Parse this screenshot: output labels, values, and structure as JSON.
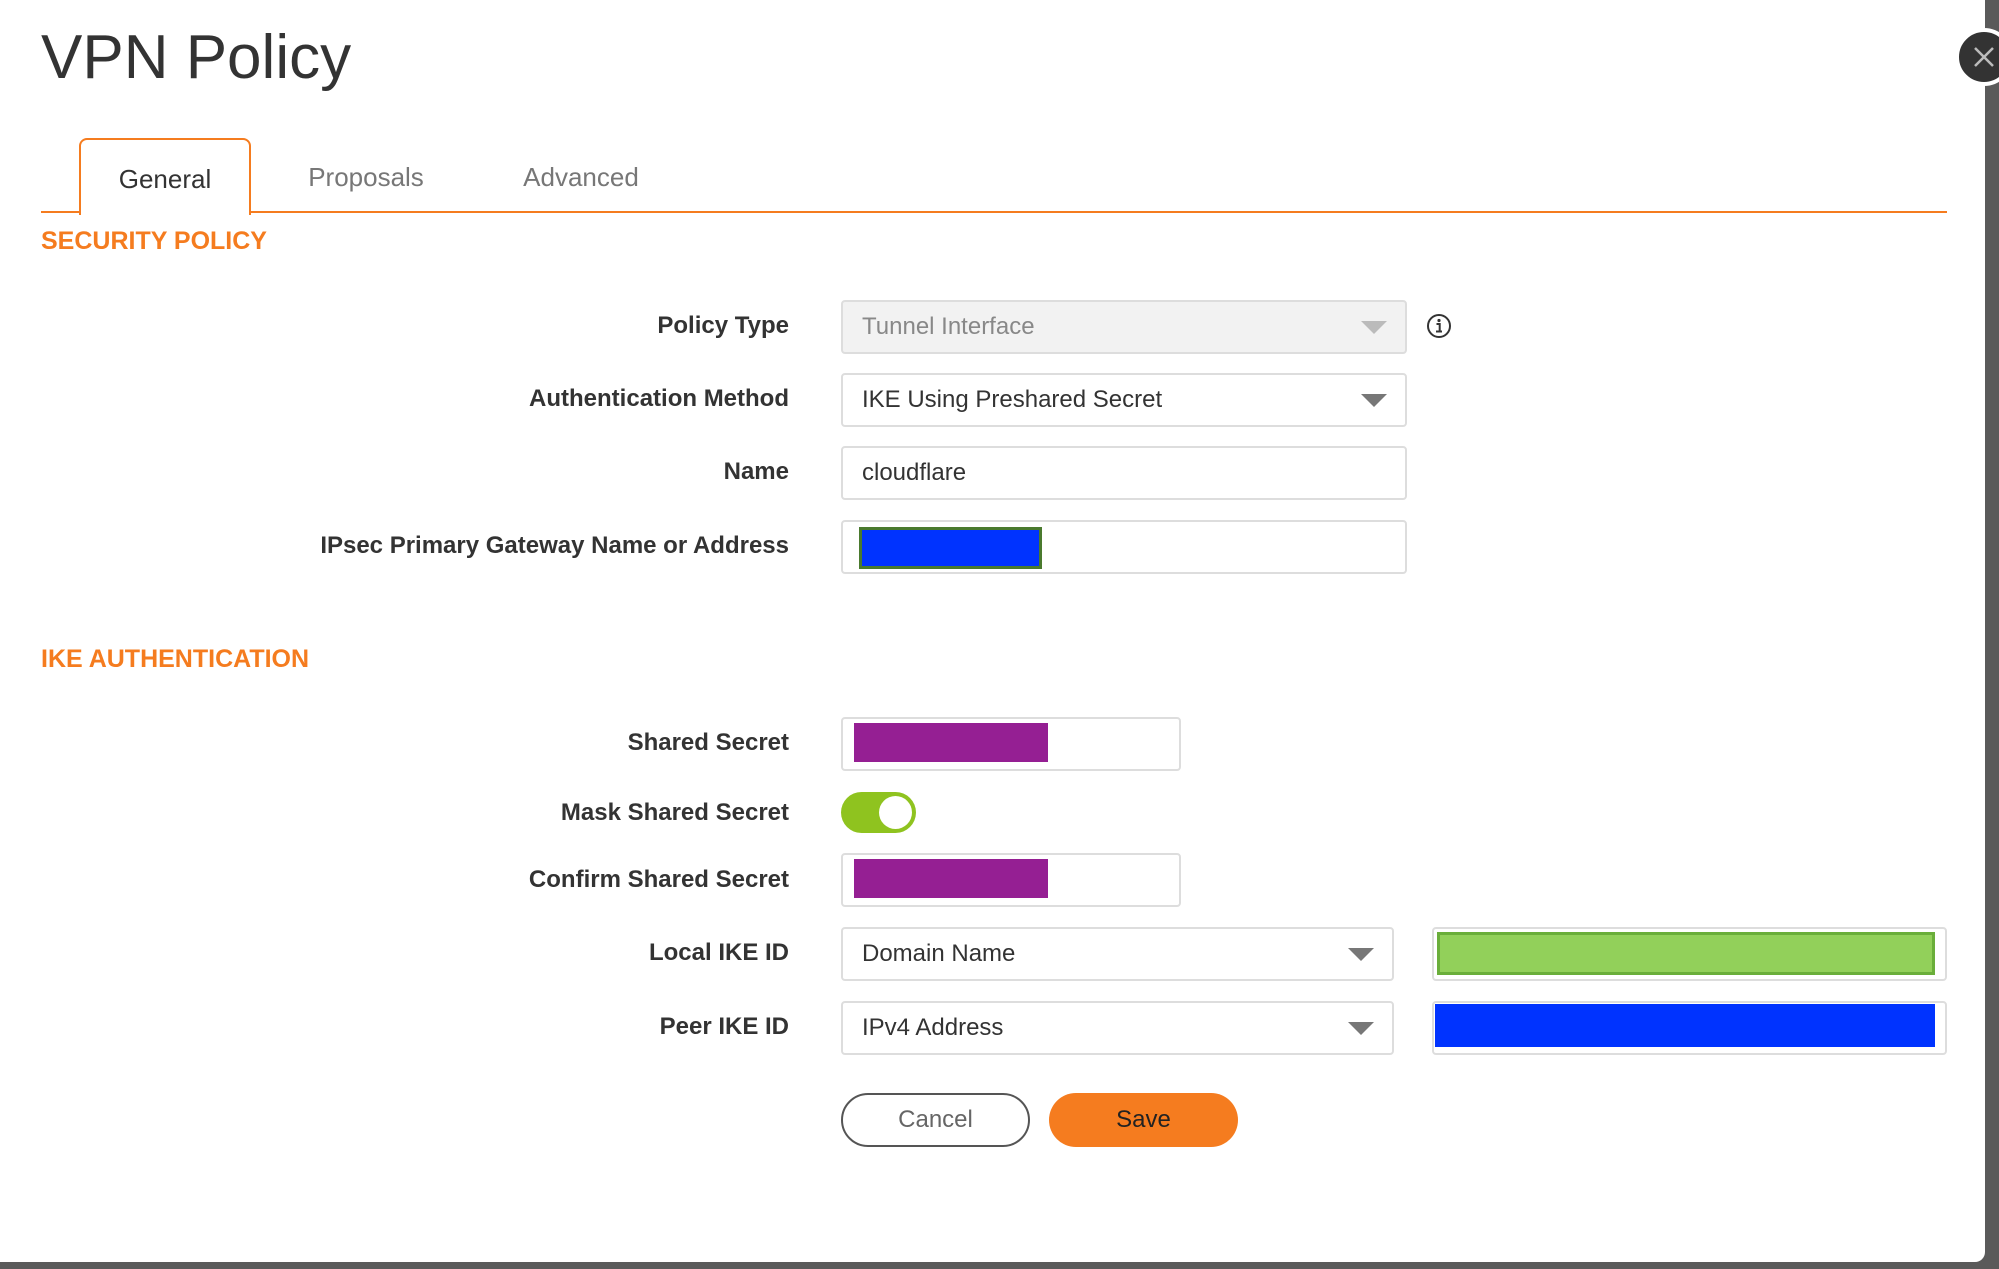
{
  "dialog": {
    "title": "VPN Policy"
  },
  "tabs": [
    {
      "label": "General",
      "active": true
    },
    {
      "label": "Proposals"
    },
    {
      "label": "Advanced"
    }
  ],
  "security_policy": {
    "heading": "SECURITY POLICY",
    "policy_type": {
      "label": "Policy Type",
      "value": "Tunnel Interface",
      "disabled": true
    },
    "auth_method": {
      "label": "Authentication Method",
      "value": "IKE Using Preshared Secret"
    },
    "name": {
      "label": "Name",
      "value": "cloudflare"
    },
    "gateway": {
      "label": "IPsec Primary Gateway Name or Address",
      "redaction_color": "#0033ff"
    }
  },
  "ike_auth": {
    "heading": "IKE AUTHENTICATION",
    "shared_secret": {
      "label": "Shared Secret",
      "redaction_color": "#951f93"
    },
    "mask": {
      "label": "Mask Shared Secret",
      "on": true,
      "color": "#8fc31f"
    },
    "confirm_secret": {
      "label": "Confirm Shared Secret",
      "redaction_color": "#951f93"
    },
    "local_ike": {
      "label": "Local IKE ID",
      "value": "Domain Name",
      "redaction_color": "#92d05a"
    },
    "peer_ike": {
      "label": "Peer IKE ID",
      "value": "IPv4 Address",
      "redaction_color": "#0033ff"
    }
  },
  "buttons": {
    "cancel": "Cancel",
    "save": "Save"
  },
  "colors": {
    "accent": "#f57c1f"
  }
}
